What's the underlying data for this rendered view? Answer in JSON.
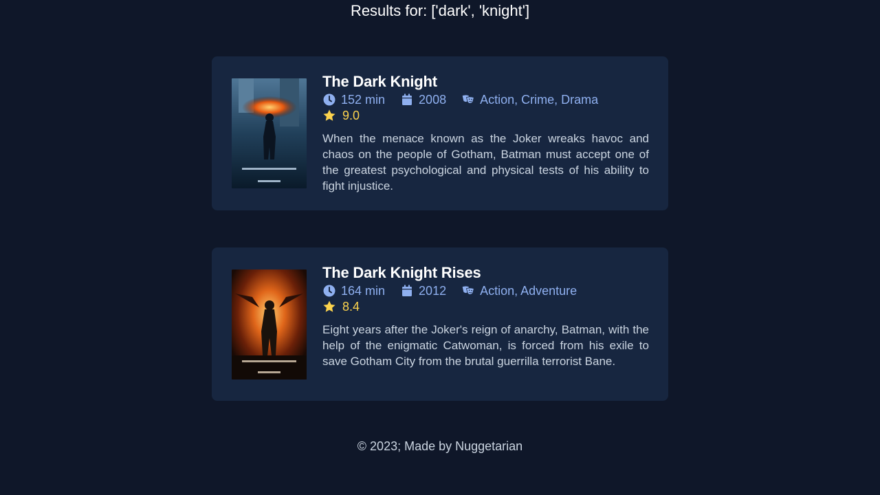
{
  "search": {
    "results_heading": "Results for: ['dark', 'knight']"
  },
  "movies": [
    {
      "title": "The Dark Knight",
      "runtime": "152 min",
      "year": "2008",
      "genres": "Action, Crime, Drama",
      "rating": "9.0",
      "description": "When the menace known as the Joker wreaks havoc and chaos on the people of Gotham, Batman must accept one of the greatest psychological and physical tests of his ability to fight injustice.",
      "poster_icon": "movie-poster-image"
    },
    {
      "title": "The Dark Knight Rises",
      "runtime": "164 min",
      "year": "2012",
      "genres": "Action, Adventure",
      "rating": "8.4",
      "description": "Eight years after the Joker's reign of anarchy, Batman, with the help of the enigmatic Catwoman, is forced from his exile to save Gotham City from the brutal guerrilla terrorist Bane.",
      "poster_icon": "movie-poster-image"
    }
  ],
  "footer": {
    "text": "© 2023; Made by Nuggetarian"
  },
  "colors": {
    "background": "#0f1729",
    "card": "#172640",
    "meta": "#8fb0f0",
    "rating": "#fcd34d",
    "text": "#cbd5e1"
  },
  "icons": {
    "runtime": "clock-icon",
    "year": "calendar-icon",
    "genres": "theater-masks-icon",
    "rating": "star-icon"
  }
}
